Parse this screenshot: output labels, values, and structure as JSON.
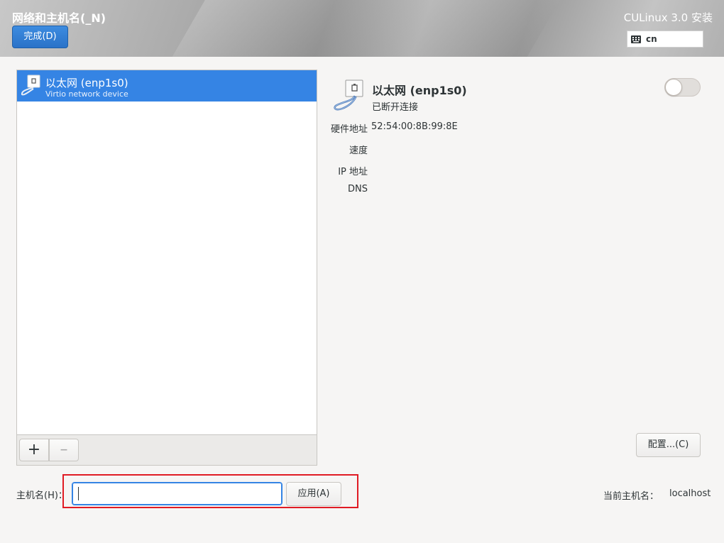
{
  "header": {
    "title": "网络和主机名(_N)",
    "done_label": "完成(D)",
    "product": "CULinux 3.0 安装",
    "keyboard_layout": "cn"
  },
  "devices": [
    {
      "name": "以太网 (enp1s0)",
      "description": "Virtio network device",
      "icon": "ethernet-icon",
      "selected": true
    }
  ],
  "list_toolbar": {
    "add_label": "+",
    "remove_label": "–"
  },
  "details": {
    "name": "以太网 (enp1s0)",
    "status": "已断开连接",
    "enabled": false,
    "properties": [
      {
        "label": "硬件地址",
        "value": "52:54:00:8B:99:8E"
      },
      {
        "label": "速度",
        "value": ""
      },
      {
        "label": "IP 地址",
        "value": ""
      },
      {
        "label": "DNS",
        "value": ""
      }
    ],
    "configure_label": "配置...(C)"
  },
  "hostname": {
    "label": "主机名(H)：",
    "value": "",
    "apply_label": "应用(A)",
    "current_label": "当前主机名：",
    "current_value": "localhost"
  },
  "colors": {
    "accent": "#3584e4",
    "highlight_border": "#e01b24"
  }
}
